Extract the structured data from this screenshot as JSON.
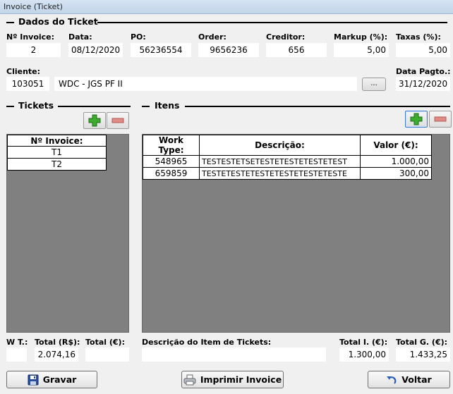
{
  "window": {
    "title": "Invoice (Ticket)"
  },
  "dados": {
    "section_title": "Dados do Ticket",
    "labels": {
      "invoice": "Nº Invoice:",
      "data": "Data:",
      "po": "PO:",
      "order": "Order:",
      "creditor": "Creditor:",
      "markup": "Markup (%):",
      "taxas": "Taxas (%):",
      "cliente": "Cliente:",
      "data_pagto": "Data Pagto.:"
    },
    "values": {
      "invoice": "2",
      "data": "08/12/2020",
      "po": "56236554",
      "order": "9656236",
      "creditor": "656",
      "markup": "5,00",
      "taxas": "5,00",
      "cliente_code": "103051",
      "cliente_name": "WDC - JGS PF II",
      "data_pagto": "31/12/2020"
    },
    "lookup_button": "..."
  },
  "tickets": {
    "section_title": "Tickets",
    "columns": [
      "Nº Invoice:"
    ],
    "rows": [
      [
        "T1"
      ],
      [
        "T2"
      ]
    ]
  },
  "itens": {
    "section_title": "Itens",
    "columns": [
      "Work Type:",
      "Descrição:",
      "Valor (€):"
    ],
    "rows": [
      [
        "548965",
        "TESTESTETSETESTETESTETESTETEST",
        "1.000,00"
      ],
      [
        "659859",
        "TESTETESTETESTETESTETESTETESTE",
        "300,00"
      ]
    ]
  },
  "footer": {
    "labels": {
      "wt": "W T.:",
      "total_brl": "Total (R$):",
      "total_eur": "Total (€):",
      "descricao": "Descrição do Item de Tickets:",
      "total_i": "Total I. (€):",
      "total_g": "Total G. (€):"
    },
    "values": {
      "wt": "",
      "total_brl": "2.074,16",
      "total_eur": "",
      "descricao": "",
      "total_i": "1.300,00",
      "total_g": "1.433,25"
    }
  },
  "buttons": {
    "gravar": "Gravar",
    "imprimir": "Imprimir Invoice",
    "voltar": "Voltar"
  },
  "colors": {
    "grid_background": "#808080",
    "add_icon": "#3cab2f",
    "remove_icon": "#e08c86"
  }
}
